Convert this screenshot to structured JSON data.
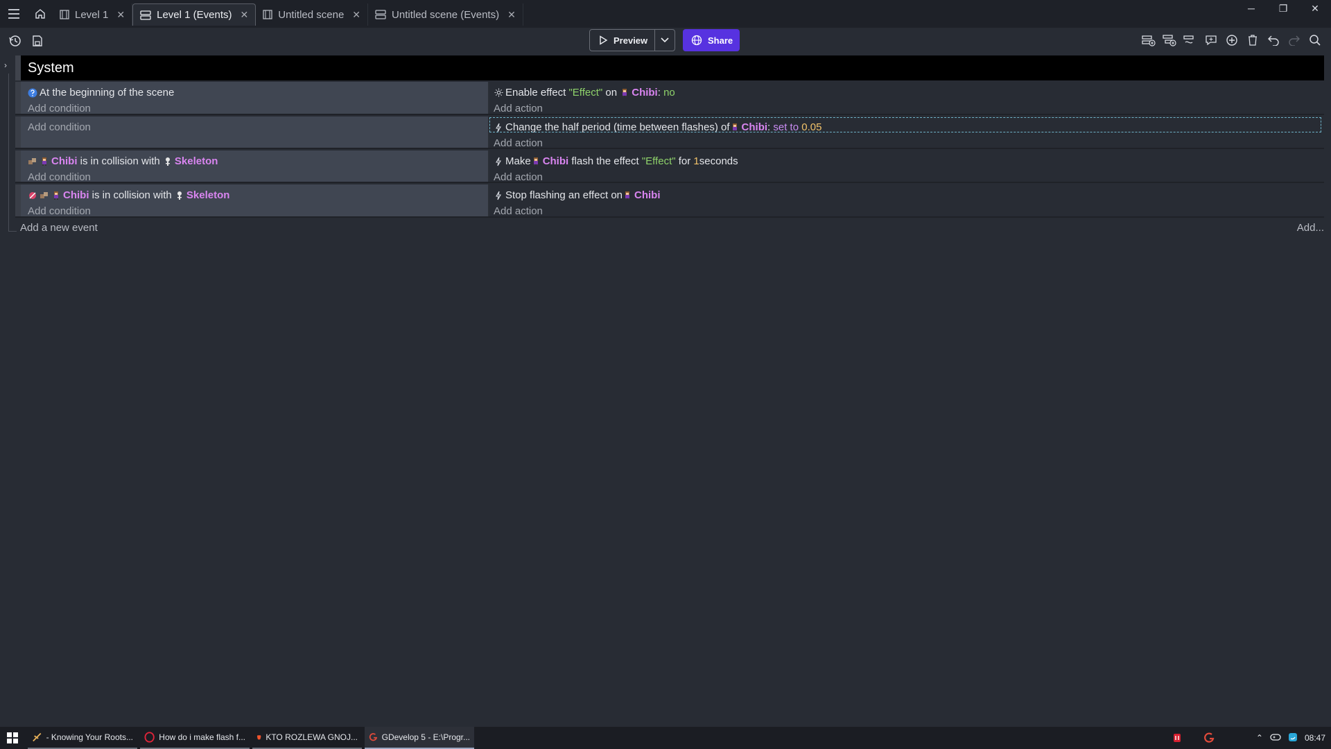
{
  "tabs": [
    {
      "label": "Level 1",
      "icon": "scene-icon",
      "active": false
    },
    {
      "label": "Level 1 (Events)",
      "icon": "events-icon",
      "active": true
    },
    {
      "label": "Untitled scene",
      "icon": "scene-icon",
      "active": false
    },
    {
      "label": "Untitled scene (Events)",
      "icon": "events-icon",
      "active": false
    }
  ],
  "toolbar": {
    "preview_label": "Preview",
    "share_label": "Share"
  },
  "group": {
    "title": "System"
  },
  "events": [
    {
      "conditions": [
        {
          "text": "At the beginning of the scene"
        }
      ],
      "add_condition": "Add condition",
      "actions": [
        {
          "prefix": "Enable effect ",
          "str": "\"Effect\"",
          "mid": " on ",
          "obj": "Chibi",
          "suffix": ": ",
          "val": "no"
        }
      ],
      "add_action": "Add action"
    },
    {
      "conditions": [],
      "add_condition": "Add condition",
      "actions": [
        {
          "prefix": "Change the half period (time between flashes) of ",
          "obj": "Chibi",
          "suffix": ": ",
          "op": "set to",
          "num": "0.05"
        }
      ],
      "add_action": "Add action"
    },
    {
      "conditions": [
        {
          "obj": "Chibi",
          "mid": " is in collision with ",
          "obj2": "Skeleton"
        }
      ],
      "add_condition": "Add condition",
      "actions": [
        {
          "prefix": "Make ",
          "obj": "Chibi",
          "mid": " flash the effect ",
          "str": "\"Effect\"",
          "mid2": " for ",
          "num": "1",
          "suffix": " seconds"
        }
      ],
      "add_action": "Add action"
    },
    {
      "conditions": [
        {
          "obj": "Chibi",
          "mid": " is in collision with ",
          "obj2": "Skeleton"
        }
      ],
      "add_condition": "Add condition",
      "actions": [
        {
          "prefix": "Stop flashing an effect on ",
          "obj": "Chibi"
        }
      ],
      "add_action": "Add action"
    }
  ],
  "add_new_event": "Add a new event",
  "add_more": "Add...",
  "taskbar": {
    "items": [
      {
        "label": "- Knowing Your Roots..."
      },
      {
        "label": "How do i make flash f..."
      },
      {
        "label": "KTO ROZLEWA GNOJ..."
      },
      {
        "label": "GDevelop 5 - E:\\Progr..."
      }
    ],
    "clock": "08:47"
  },
  "colors": {
    "accent": "#5732e0",
    "object": "#d985f0",
    "string": "#8fd36b",
    "number": "#f3c36a"
  }
}
